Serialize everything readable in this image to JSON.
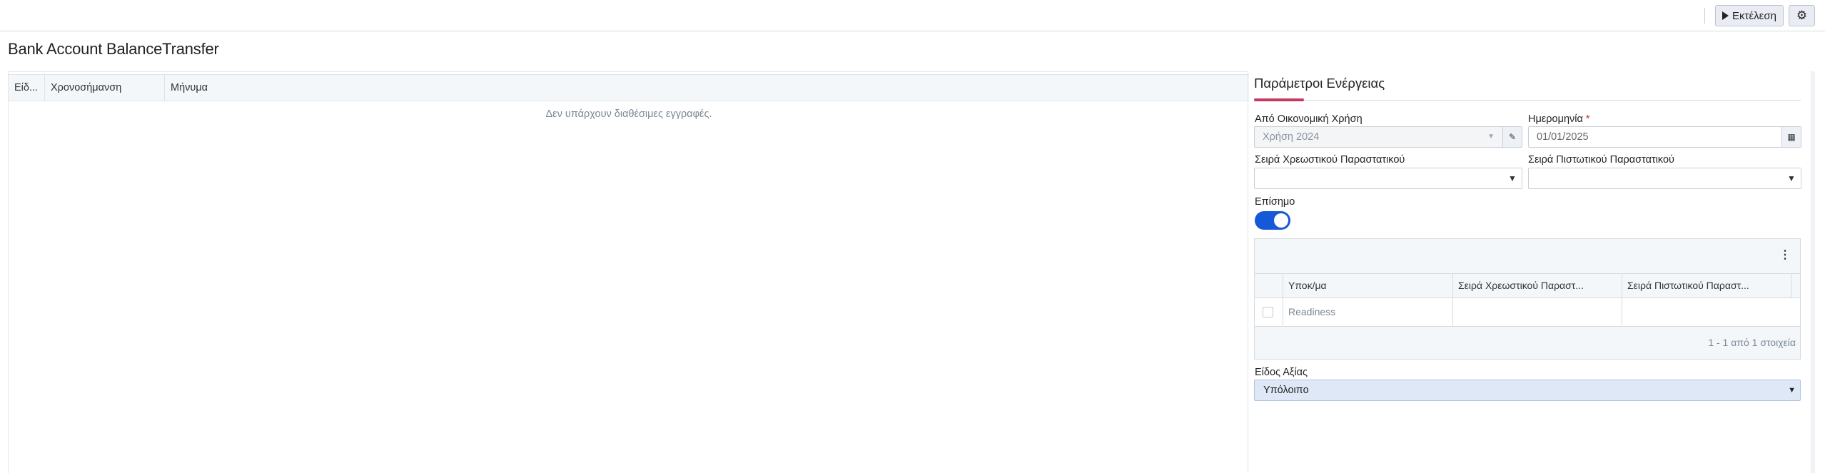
{
  "toolbar": {
    "run_label": "Εκτέλεση",
    "settings_icon": "gear-icon"
  },
  "page": {
    "title": "Bank Account BalanceTransfer"
  },
  "log_grid": {
    "columns": [
      "Είδ...",
      "Χρονοσήμανση",
      "Μήνυμα"
    ],
    "empty_text": "Δεν υπάρχουν διαθέσιμες εγγραφές."
  },
  "params": {
    "title": "Παράμετροι Ενέργειας",
    "fiscal_year": {
      "label": "Από Οικονομική Χρήση",
      "value": "Χρήση 2024"
    },
    "date": {
      "label": "Ημερομηνία",
      "required_mark": "*",
      "value": "01/01/2025"
    },
    "debit_series": {
      "label": "Σειρά Χρεωστικού Παραστατικού",
      "value": ""
    },
    "credit_series": {
      "label": "Σειρά Πιστωτικού Παραστατικού",
      "value": ""
    },
    "official": {
      "label": "Επίσημο",
      "checked": true
    },
    "branches_grid": {
      "columns": [
        "Υποκ/μα",
        "Σειρά Χρεωστικού Παραστ...",
        "Σειρά Πιστωτικού Παραστ..."
      ],
      "rows": [
        {
          "branch": "Readiness",
          "debit": "",
          "credit": ""
        }
      ],
      "footer": "1 - 1 από 1 στοιχεία"
    },
    "value_type": {
      "label": "Είδος Αξίας",
      "value": "Υπόλοιπο"
    }
  }
}
